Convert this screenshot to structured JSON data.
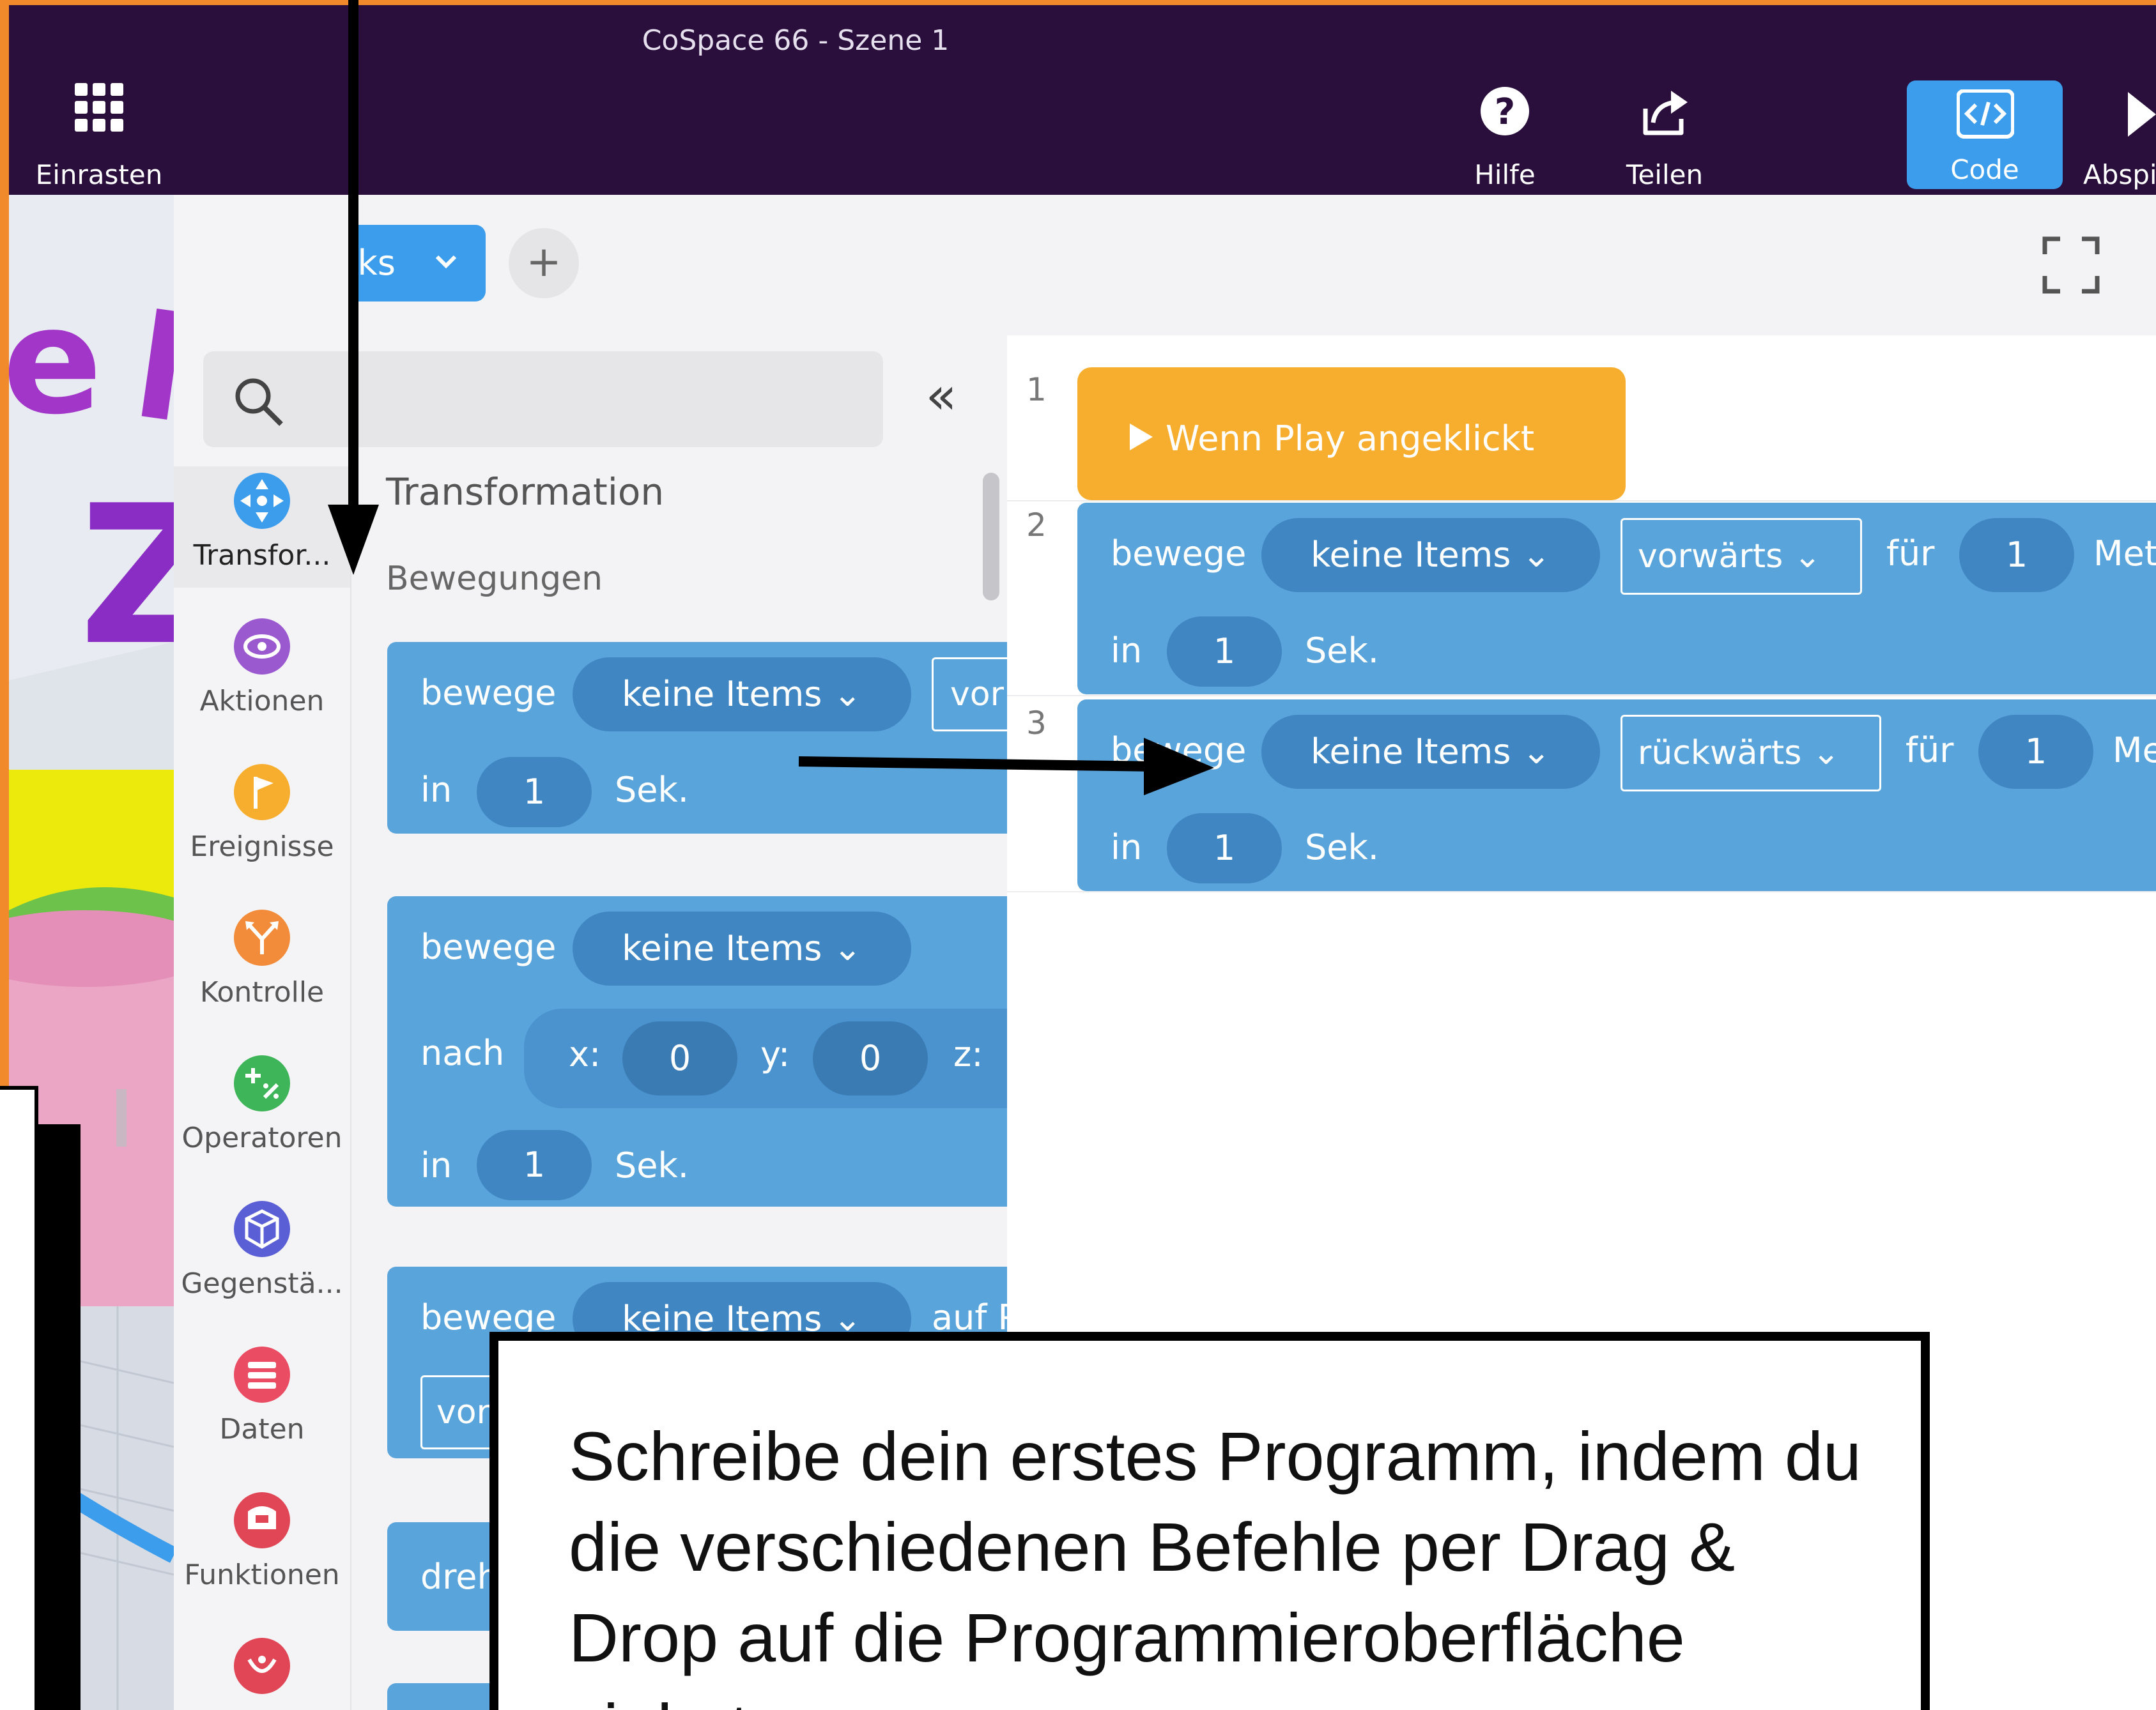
{
  "window": {
    "title": "CoSpace 66 - Szene 1"
  },
  "topbar": {
    "snap": {
      "label": "Einrasten",
      "icon": "grid-icon"
    },
    "help": {
      "label": "Hilfe",
      "icon": "help-icon"
    },
    "share": {
      "label": "Teilen",
      "icon": "share-icon"
    },
    "code": {
      "label": "Code",
      "icon": "code-icon"
    },
    "play": {
      "label": "Abspi",
      "icon": "play-icon"
    }
  },
  "editor": {
    "tab_label": "CoBlocks",
    "add_tab": "+",
    "collapse": "«"
  },
  "sidebar": {
    "categories": [
      {
        "label": "Transfor...",
        "color": "#3c9ded",
        "icon": "move-icon"
      },
      {
        "label": "Aktionen",
        "color": "#9b59d0",
        "icon": "eye-icon"
      },
      {
        "label": "Ereignisse",
        "color": "#f7ae2f",
        "icon": "flag-icon"
      },
      {
        "label": "Kontrolle",
        "color": "#f28c3a",
        "icon": "branch-icon"
      },
      {
        "label": "Operatoren",
        "color": "#3fb55a",
        "icon": "operator-icon"
      },
      {
        "label": "Gegenstä...",
        "color": "#5b5fd6",
        "icon": "cube-icon"
      },
      {
        "label": "Daten",
        "color": "#ea4d63",
        "icon": "data-icon"
      },
      {
        "label": "Funktionen",
        "color": "#e04655",
        "icon": "function-icon"
      },
      {
        "label": "",
        "color": "#e04655",
        "icon": "more-icon"
      }
    ]
  },
  "palette": {
    "title": "Transformation",
    "subtitle": "Bewegungen",
    "block1": {
      "verb": "bewege",
      "item": "keine Items",
      "dir": "vor",
      "in": "in",
      "num": "1",
      "unit": "Sek."
    },
    "block2": {
      "verb": "bewege",
      "item": "keine Items",
      "to": "nach",
      "x_lbl": "x:",
      "x": "0",
      "y_lbl": "y:",
      "y": "0",
      "z_lbl": "z:",
      "in": "in",
      "num": "1",
      "unit": "Sek."
    },
    "block3": {
      "verb": "bewege",
      "item": "keine Items",
      "on": "auf P",
      "dir": "vor"
    },
    "block4": {
      "verb": "dreh"
    }
  },
  "canvas": {
    "lines": [
      "1",
      "2",
      "3"
    ],
    "hat": {
      "label": "Wenn Play angeklickt"
    },
    "stmt1": {
      "verb": "bewege",
      "item": "keine Items",
      "dir": "vorwärts",
      "for": "für",
      "num": "1",
      "unit": "Met",
      "in": "in",
      "time": "1",
      "sec": "Sek."
    },
    "stmt2": {
      "verb": "bewege",
      "item": "keine Items",
      "dir": "rückwärts",
      "for": "für",
      "num": "1",
      "unit": "Me",
      "in": "in",
      "time": "1",
      "sec": "Sek."
    }
  },
  "callout": {
    "text": "Schreibe dein erstes Programm, indem du die verschiedenen Befehle per Drag & Drop auf die Programmieroberfläche ziehst."
  },
  "scene": {
    "letters": [
      "e",
      "Z"
    ]
  }
}
